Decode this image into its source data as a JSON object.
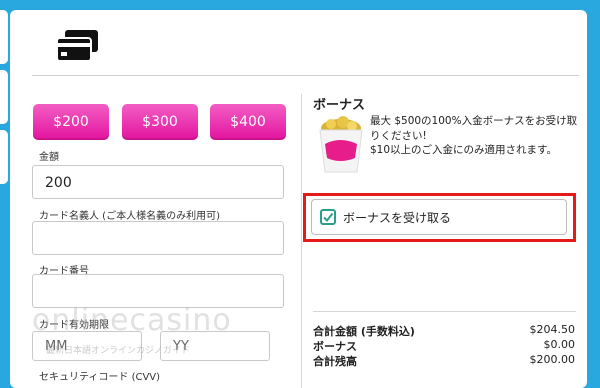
{
  "payment": {
    "amount_options": [
      "$200",
      "$300",
      "$400"
    ],
    "amount_label": "金額",
    "amount_value": "200",
    "cardholder_label": "カード名義人 (ご本人様名義のみ利用可)",
    "card_number_label": "カード番号",
    "expiry_label": "カード有効期限",
    "expiry_month_placeholder": "MM",
    "expiry_year_placeholder": "YY",
    "cvv_label": "セキュリティコード (CVV)"
  },
  "bonus": {
    "title": "ボーナス",
    "line1": "最大 $500の100%入金ボーナスをお受け取りください!",
    "line2": "$10以上のご入金にのみ適用されます。",
    "claim_label": "ボーナスを受け取る",
    "claimed": true
  },
  "summary": {
    "rows": [
      {
        "label": "合計金額 (手数料込)",
        "value": "$204.50"
      },
      {
        "label": "ボーナス",
        "value": "$0.00"
      },
      {
        "label": "合計残高",
        "value": "$200.00"
      }
    ]
  },
  "watermark": {
    "text": "onlinecasino",
    "sub": "最新日本語オンラインカジノガイド"
  },
  "colors": {
    "background": "#29a8e0",
    "button_pink": "#e4139f",
    "highlight_red": "#e61a1a",
    "check_green": "#2a9e8a"
  },
  "icons": {
    "card": "credit-card-icon",
    "check": "check-icon"
  }
}
